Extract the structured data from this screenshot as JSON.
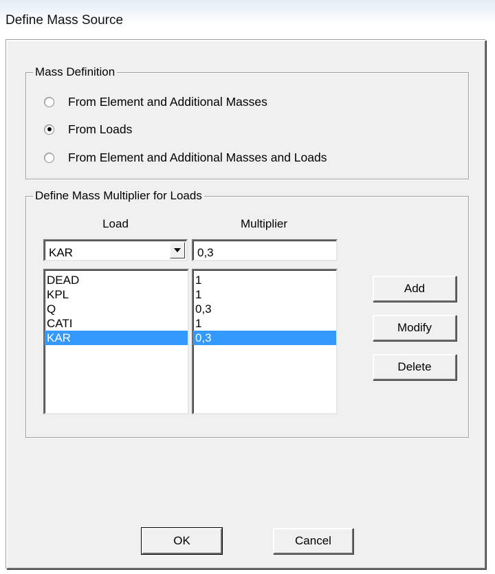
{
  "window": {
    "title": "Define Mass Source"
  },
  "mass_definition": {
    "legend": "Mass Definition",
    "options": [
      {
        "label": "From Element and Additional Masses",
        "selected": false
      },
      {
        "label": "From Loads",
        "selected": true
      },
      {
        "label": "From Element and Additional Masses and Loads",
        "selected": false
      }
    ]
  },
  "multiplier_group": {
    "legend": "Define Mass Multiplier for Loads",
    "load_header": "Load",
    "multiplier_header": "Multiplier",
    "load_combo_value": "KAR",
    "multiplier_input_value": "0,3",
    "loads": [
      "DEAD",
      "KPL",
      "Q",
      "CATI",
      "KAR"
    ],
    "multipliers": [
      "1",
      "1",
      "0,3",
      "1",
      "0,3"
    ],
    "selected_index": 4,
    "add_label": "Add",
    "modify_label": "Modify",
    "delete_label": "Delete"
  },
  "footer": {
    "ok_label": "OK",
    "cancel_label": "Cancel"
  },
  "colors": {
    "selection": "#3399ff",
    "dialog_bg": "#f0f0f0"
  }
}
